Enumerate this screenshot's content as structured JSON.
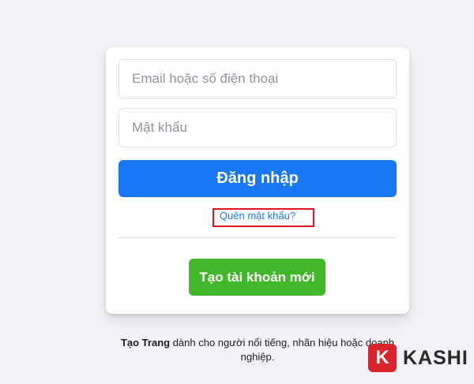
{
  "login_form": {
    "email_placeholder": "Email hoặc số điện thoại",
    "password_placeholder": "Mật khẩu",
    "login_label": "Đăng nhập",
    "forgot_password_label": "Quên mật khẩu?",
    "create_account_label": "Tạo tài khoản mới"
  },
  "footer": {
    "create_page_link": "Tạo Trang",
    "create_page_text": " dành cho người nổi tiếng, nhãn hiệu hoặc doanh nghiệp."
  },
  "watermark": {
    "badge_letter": "K",
    "brand": "KASHI"
  },
  "colors": {
    "primary_blue": "#1877f2",
    "create_green": "#42b72a",
    "highlight_red": "#e0141e",
    "background": "#f0f2f5"
  }
}
